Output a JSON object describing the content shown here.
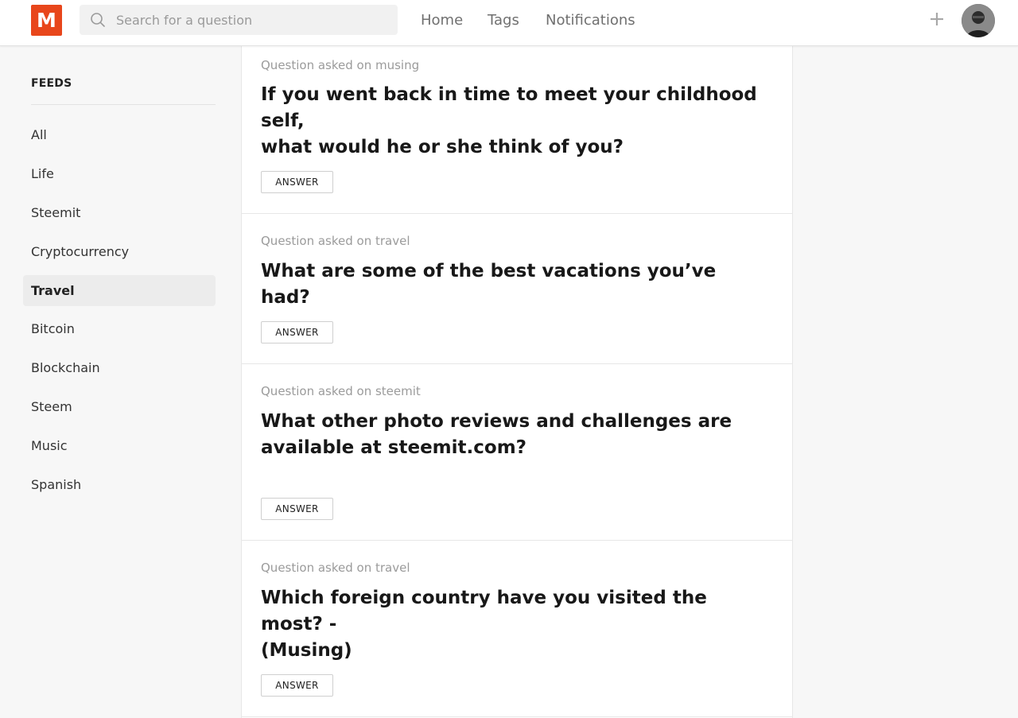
{
  "header": {
    "logo_letter": "M",
    "search_placeholder": "Search for a question",
    "nav": [
      "Home",
      "Tags",
      "Notifications"
    ],
    "brand_color": "#e8461b"
  },
  "sidebar": {
    "title": "FEEDS",
    "items": [
      "All",
      "Life",
      "Steemit",
      "Cryptocurrency",
      "Travel",
      "Bitcoin",
      "Blockchain",
      "Steem",
      "Music",
      "Spanish"
    ],
    "active": "Travel"
  },
  "questions": [
    {
      "meta": "Question asked on musing",
      "title_lines": [
        "If you went back in time to meet your childhood self,",
        "what would he or she think of you?"
      ],
      "answer_label": "ANSWER"
    },
    {
      "meta": "Question asked on travel",
      "title_lines": [
        "What are some of the best vacations you’ve had?"
      ],
      "answer_label": "ANSWER"
    },
    {
      "meta": "Question asked on steemit",
      "title_lines": [
        "What other photo reviews and challenges are",
        "available at steemit.com?"
      ],
      "answer_label": "ANSWER"
    },
    {
      "meta": "Question asked on travel",
      "title_lines": [
        "Which foreign country have you visited the most? -",
        "(Musing)"
      ],
      "answer_label": "ANSWER"
    }
  ]
}
